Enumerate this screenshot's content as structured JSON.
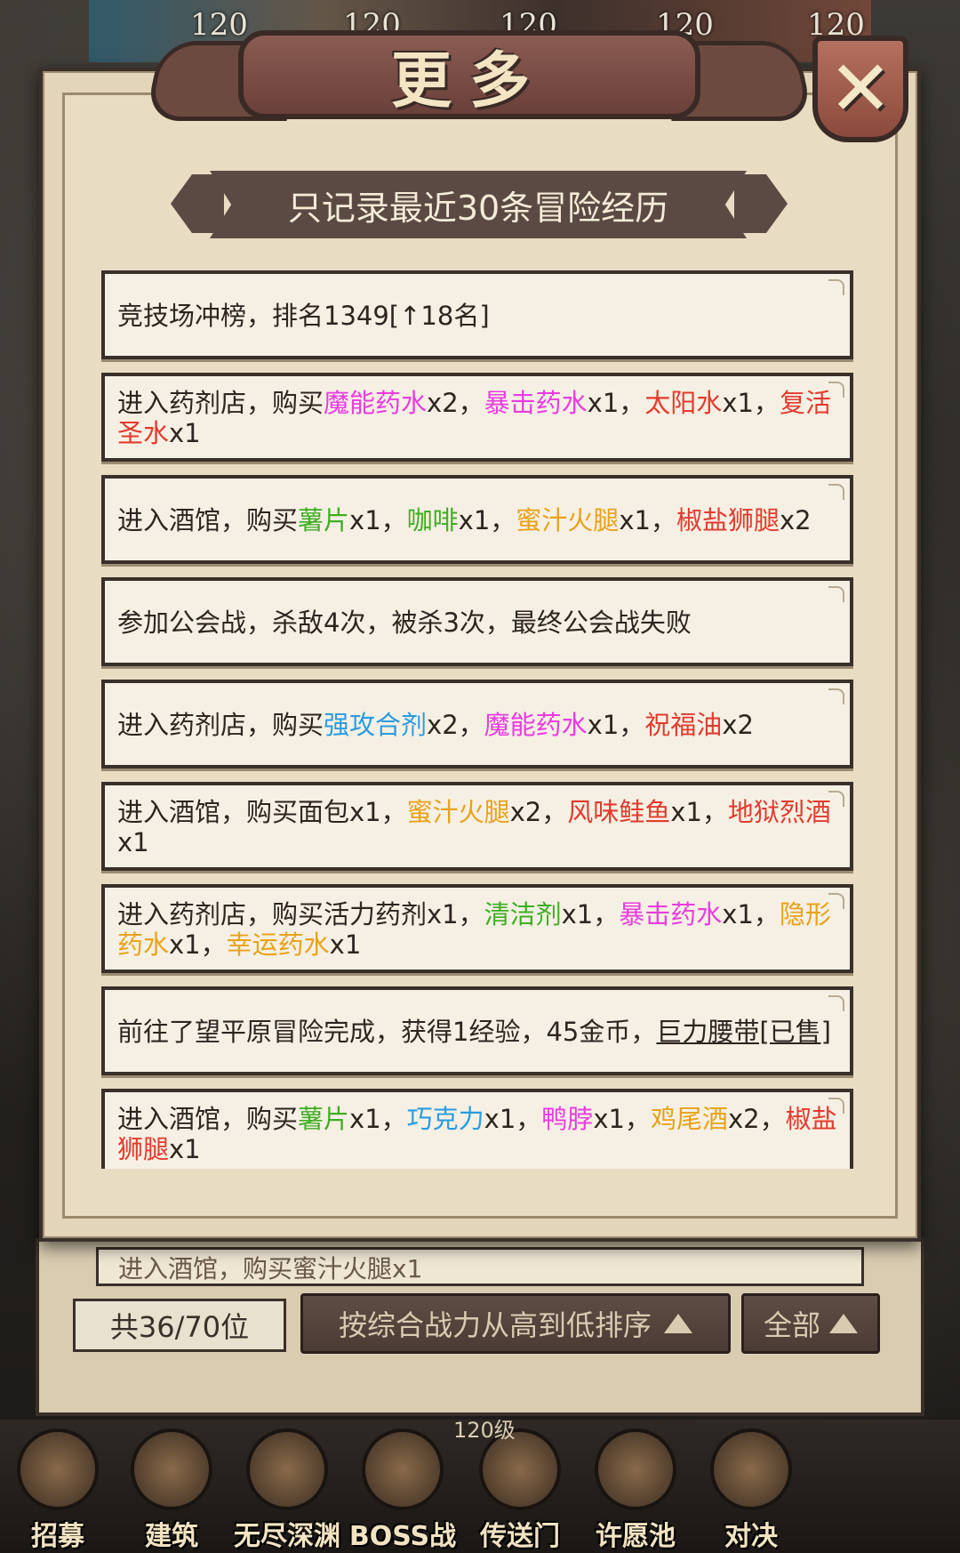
{
  "background": {
    "levels": [
      "120",
      "120",
      "120",
      "120",
      "120"
    ]
  },
  "popup": {
    "title": "更多",
    "subtitle": "只记录最近30条冒险经历",
    "close_icon": "close-x-icon"
  },
  "log_entries": [
    {
      "parts": [
        {
          "t": "竞技场冲榜，排名1349[↑18名]",
          "c": "text"
        }
      ]
    },
    {
      "parts": [
        {
          "t": "进入药剂店，购买",
          "c": "text"
        },
        {
          "t": "魔能药水",
          "c": "magenta"
        },
        {
          "t": "x2，",
          "c": "text"
        },
        {
          "t": "暴击药水",
          "c": "magenta"
        },
        {
          "t": "x1，",
          "c": "text"
        },
        {
          "t": "太阳水",
          "c": "red"
        },
        {
          "t": "x1，",
          "c": "text"
        },
        {
          "t": "复活圣水",
          "c": "red"
        },
        {
          "t": "x1",
          "c": "text"
        }
      ]
    },
    {
      "parts": [
        {
          "t": "进入酒馆，购买",
          "c": "text"
        },
        {
          "t": "薯片",
          "c": "green"
        },
        {
          "t": "x1，",
          "c": "text"
        },
        {
          "t": "咖啡",
          "c": "green"
        },
        {
          "t": "x1，",
          "c": "text"
        },
        {
          "t": "蜜汁火腿",
          "c": "gold"
        },
        {
          "t": "x1，",
          "c": "text"
        },
        {
          "t": "椒盐狮腿",
          "c": "red"
        },
        {
          "t": "x2",
          "c": "text"
        }
      ]
    },
    {
      "parts": [
        {
          "t": "参加公会战，杀敌4次，被杀3次，最终公会战失败",
          "c": "text"
        }
      ]
    },
    {
      "parts": [
        {
          "t": "进入药剂店，购买",
          "c": "text"
        },
        {
          "t": "强攻合剂",
          "c": "blue"
        },
        {
          "t": "x2，",
          "c": "text"
        },
        {
          "t": "魔能药水",
          "c": "magenta"
        },
        {
          "t": "x1，",
          "c": "text"
        },
        {
          "t": "祝福油",
          "c": "red"
        },
        {
          "t": "x2",
          "c": "text"
        }
      ]
    },
    {
      "parts": [
        {
          "t": "进入酒馆，购买面包x1，",
          "c": "text"
        },
        {
          "t": "蜜汁火腿",
          "c": "gold"
        },
        {
          "t": "x2，",
          "c": "text"
        },
        {
          "t": "风味鲑鱼",
          "c": "red"
        },
        {
          "t": "x1，",
          "c": "text"
        },
        {
          "t": "地狱烈酒",
          "c": "red"
        },
        {
          "t": "x1",
          "c": "text"
        }
      ]
    },
    {
      "parts": [
        {
          "t": "进入药剂店，购买活力药剂x1，",
          "c": "text"
        },
        {
          "t": "清洁剂",
          "c": "green"
        },
        {
          "t": "x1，",
          "c": "text"
        },
        {
          "t": "暴击药水",
          "c": "magenta"
        },
        {
          "t": "x1，",
          "c": "text"
        },
        {
          "t": "隐形药水",
          "c": "gold"
        },
        {
          "t": "x1，",
          "c": "text"
        },
        {
          "t": "幸运药水",
          "c": "gold"
        },
        {
          "t": "x1",
          "c": "text"
        }
      ]
    },
    {
      "parts": [
        {
          "t": "前往了望平原冒险完成，获得1经验，45金币，",
          "c": "text"
        },
        {
          "t": "巨力腰带[已售]",
          "c": "under"
        }
      ]
    },
    {
      "parts": [
        {
          "t": "进入酒馆，购买",
          "c": "text"
        },
        {
          "t": "薯片",
          "c": "green"
        },
        {
          "t": "x1，",
          "c": "text"
        },
        {
          "t": "巧克力",
          "c": "blue"
        },
        {
          "t": "x1，",
          "c": "text"
        },
        {
          "t": "鸭脖",
          "c": "magenta"
        },
        {
          "t": "x1，",
          "c": "text"
        },
        {
          "t": "鸡尾酒",
          "c": "gold"
        },
        {
          "t": "x2，",
          "c": "text"
        },
        {
          "t": "椒盐狮腿",
          "c": "red"
        },
        {
          "t": "x1",
          "c": "text"
        }
      ]
    }
  ],
  "lower_panel": {
    "partial_row": "进入酒馆，购买蜜汁火腿x1",
    "count": "共36/70位",
    "sort_label": "按综合战力从高到低排序",
    "filter_label": "全部"
  },
  "bottom_nav": {
    "items": [
      "招募",
      "建筑",
      "无尽深渊",
      "BOSS战",
      "传送门",
      "许愿池",
      "对决"
    ],
    "overlay": "120级"
  },
  "colors": {
    "text": "#2e2520",
    "magenta": "#e83ce0",
    "red": "#e23b2e",
    "green": "#3fae23",
    "gold": "#e8a21a",
    "blue": "#2a9ce0"
  }
}
